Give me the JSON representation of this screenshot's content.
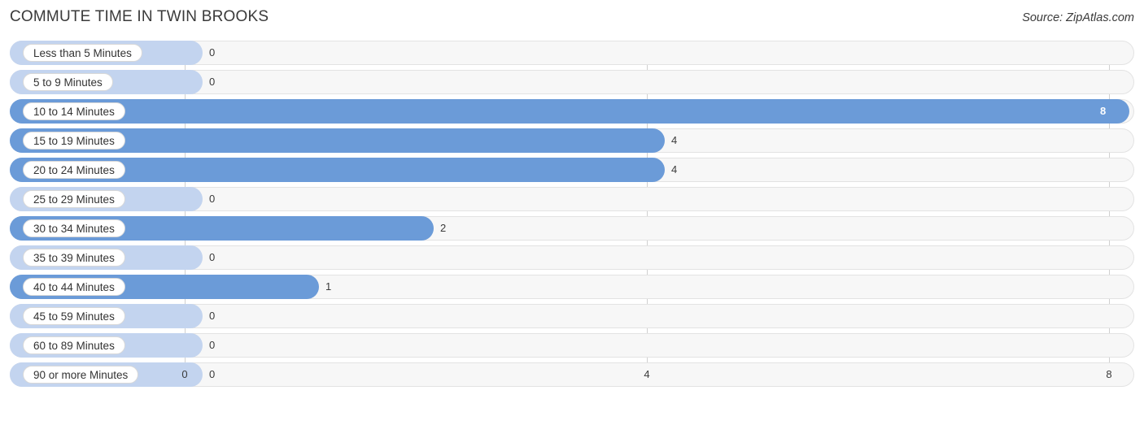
{
  "header": {
    "title": "COMMUTE TIME IN TWIN BROOKS",
    "source": "Source: ZipAtlas.com"
  },
  "chart_data": {
    "type": "bar",
    "orientation": "horizontal",
    "title": "COMMUTE TIME IN TWIN BROOKS",
    "xlabel": "",
    "ylabel": "",
    "xlim": [
      0,
      8
    ],
    "ticks": [
      "0",
      "4",
      "8"
    ],
    "tick_values": [
      0,
      4,
      8
    ],
    "grid": true,
    "legend": null,
    "categories": [
      "Less than 5 Minutes",
      "5 to 9 Minutes",
      "10 to 14 Minutes",
      "15 to 19 Minutes",
      "20 to 24 Minutes",
      "25 to 29 Minutes",
      "30 to 34 Minutes",
      "35 to 39 Minutes",
      "40 to 44 Minutes",
      "45 to 59 Minutes",
      "60 to 89 Minutes",
      "90 or more Minutes"
    ],
    "values": [
      0,
      0,
      8,
      4,
      4,
      0,
      2,
      0,
      1,
      0,
      0,
      0
    ],
    "value_labels": [
      "0",
      "0",
      "8",
      "4",
      "4",
      "0",
      "2",
      "0",
      "1",
      "0",
      "0",
      "0"
    ],
    "colors": {
      "bar": "#6b9bd8",
      "bar_zero": "#c3d4ef",
      "track": "#f7f7f7",
      "track_border": "#e3e3e3",
      "grid": "#d0d0d0"
    }
  }
}
